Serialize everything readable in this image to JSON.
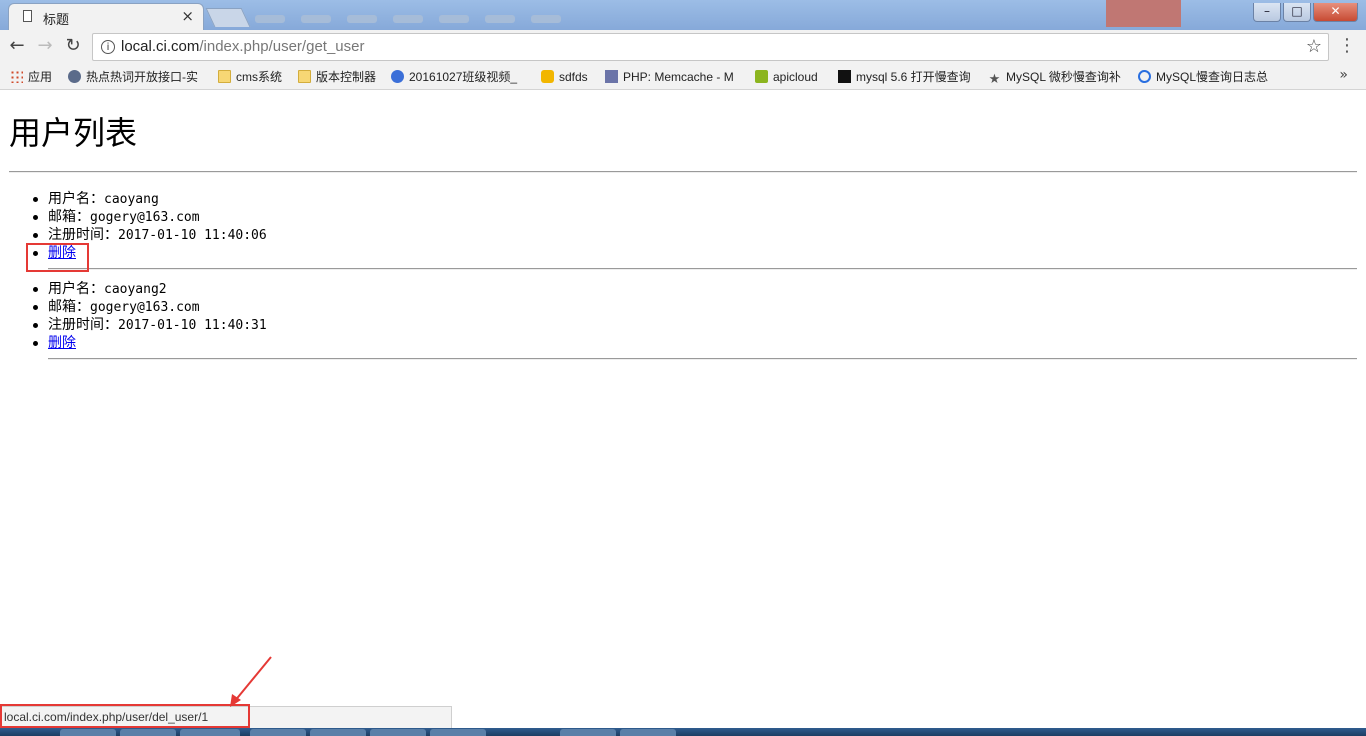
{
  "browser": {
    "tab_title": "标题",
    "tab_close": "×",
    "url_host": "local.ci.com",
    "url_path": "/index.php/user/get_user",
    "nav_back": "←",
    "nav_forward": "→",
    "nav_reload": "↻",
    "star": "☆",
    "menu": "⋮",
    "window_minimize": "–",
    "window_maximize": "□",
    "window_close": "✕",
    "bookmarks_more": "»",
    "bookmarks": [
      {
        "label": "应用",
        "icon": "apps-grid-icon"
      },
      {
        "label": "热点热词开放接口-实",
        "icon": "gear-icon"
      },
      {
        "label": "cms系统",
        "icon": "folder-icon"
      },
      {
        "label": "版本控制器",
        "icon": "folder-icon"
      },
      {
        "label": "20161027班级视频_",
        "icon": "network-icon"
      },
      {
        "label": "sdfds",
        "icon": "hand-icon"
      },
      {
        "label": "PHP: Memcache - M",
        "icon": "php-icon"
      },
      {
        "label": "apicloud",
        "icon": "apicloud-icon"
      },
      {
        "label": "mysql 5.6 打开慢查询",
        "icon": "v-icon"
      },
      {
        "label": "MySQL 微秒慢查询补",
        "icon": "star-icon"
      },
      {
        "label": "MySQL慢查询日志总",
        "icon": "ring-icon"
      }
    ]
  },
  "page": {
    "title": "用户列表",
    "users": [
      {
        "username_label": "用户名：",
        "username": "caoyang",
        "email_label": "邮箱：",
        "email": "gogery@163.com",
        "regtime_label": "注册时间：",
        "regtime": "2017-01-10 11:40:06",
        "delete_label": "删除"
      },
      {
        "username_label": "用户名：",
        "username": "caoyang2",
        "email_label": "邮箱：",
        "email": "gogery@163.com",
        "regtime_label": "注册时间：",
        "regtime": "2017-01-10 11:40:31",
        "delete_label": "删除"
      }
    ]
  },
  "status": {
    "link_url": "local.ci.com/index.php/user/del_user/1"
  },
  "colors": {
    "link": "#0000ee",
    "annotation": "#e53935"
  }
}
